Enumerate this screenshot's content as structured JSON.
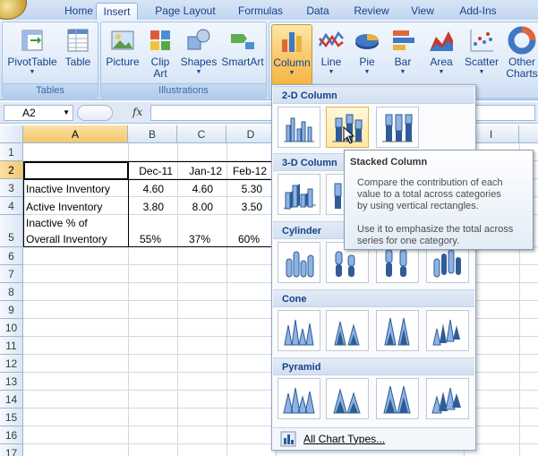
{
  "tabs": [
    {
      "label": "Home",
      "active": false
    },
    {
      "label": "Insert",
      "active": true
    },
    {
      "label": "Page Layout",
      "active": false
    },
    {
      "label": "Formulas",
      "active": false
    },
    {
      "label": "Data",
      "active": false
    },
    {
      "label": "Review",
      "active": false
    },
    {
      "label": "View",
      "active": false
    },
    {
      "label": "Add-Ins",
      "active": false
    }
  ],
  "ribbon": {
    "tables": {
      "label": "Tables",
      "pivottable": "PivotTable",
      "table": "Table"
    },
    "illustrations": {
      "label": "Illustrations",
      "picture": "Picture",
      "clipart_1": "Clip",
      "clipart_2": "Art",
      "shapes": "Shapes",
      "smartart": "SmartArt"
    },
    "charts": {
      "column": "Column",
      "line": "Line",
      "pie": "Pie",
      "bar": "Bar",
      "area": "Area",
      "scatter": "Scatter",
      "other_1": "Other",
      "other_2": "Charts"
    }
  },
  "formula_bar": {
    "name_box": "A2",
    "fx": "fx",
    "content": ""
  },
  "sheet": {
    "columns": [
      "A",
      "B",
      "C",
      "D",
      "I"
    ],
    "rows": [
      "1",
      "2",
      "3",
      "4",
      "5",
      "6",
      "7",
      "8",
      "9",
      "10",
      "11",
      "12",
      "13",
      "14",
      "15",
      "16",
      "17"
    ],
    "selected_cell": "A2",
    "header": {
      "b": "Dec-11",
      "c": "Jan-12",
      "d": "Feb-12"
    },
    "row3": {
      "label": "Inactive Inventory",
      "b": "4.60",
      "c": "4.60",
      "d": "5.30"
    },
    "row4": {
      "label": "Active Inventory",
      "b": "3.80",
      "c": "8.00",
      "d": "3.50"
    },
    "row5": {
      "label_1": "Inactive % of",
      "label_2": "Overall Inventory",
      "b": "55%",
      "c": "37%",
      "d": "60%"
    }
  },
  "gallery": {
    "sections": [
      "2-D Column",
      "3-D Column",
      "Cylinder",
      "Cone",
      "Pyramid"
    ],
    "all_chart_types": "All Chart Types..."
  },
  "tooltip": {
    "title": "Stacked Column",
    "line1": "Compare the contribution of each",
    "line2": "value to a total across categories",
    "line3": "by using vertical rectangles.",
    "line4": "Use it to emphasize the total across",
    "line5": "series for one category."
  }
}
